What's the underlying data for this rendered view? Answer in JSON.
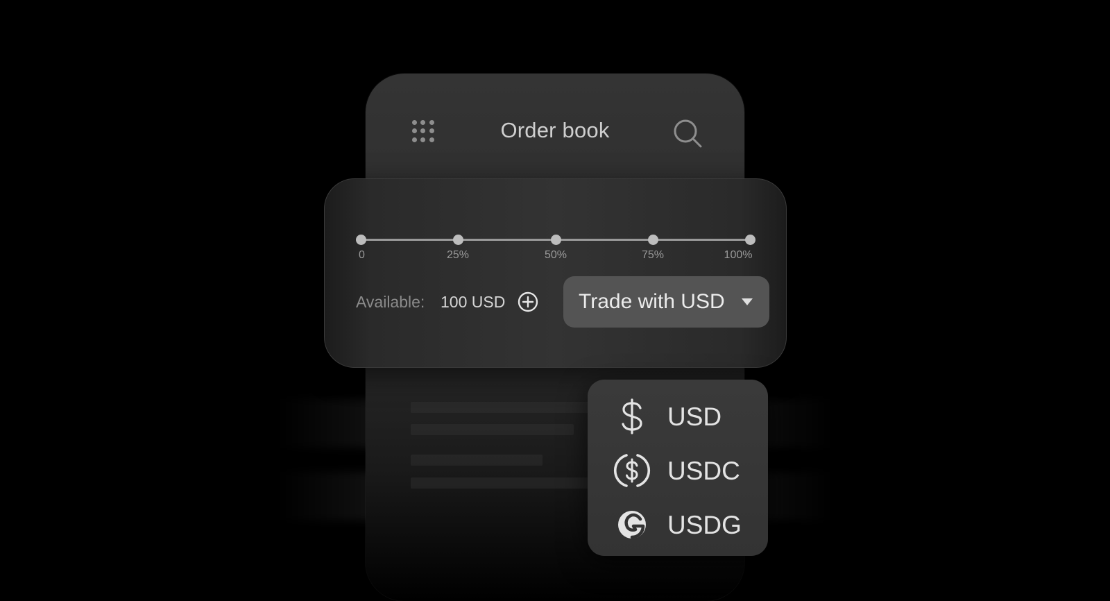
{
  "header": {
    "title": "Order book"
  },
  "slider": {
    "stops": [
      "0",
      "25%",
      "50%",
      "75%",
      "100%"
    ]
  },
  "available": {
    "label": "Available:",
    "value": "100 USD"
  },
  "trade_button": {
    "label": "Trade with USD"
  },
  "dropdown": {
    "items": [
      {
        "label": "USD",
        "icon": "dollar-icon"
      },
      {
        "label": "USDC",
        "icon": "usdc-icon"
      },
      {
        "label": "USDG",
        "icon": "usdg-icon"
      }
    ]
  },
  "colors": {
    "background": "#000000",
    "panel": "#333333",
    "button": "#545454"
  }
}
